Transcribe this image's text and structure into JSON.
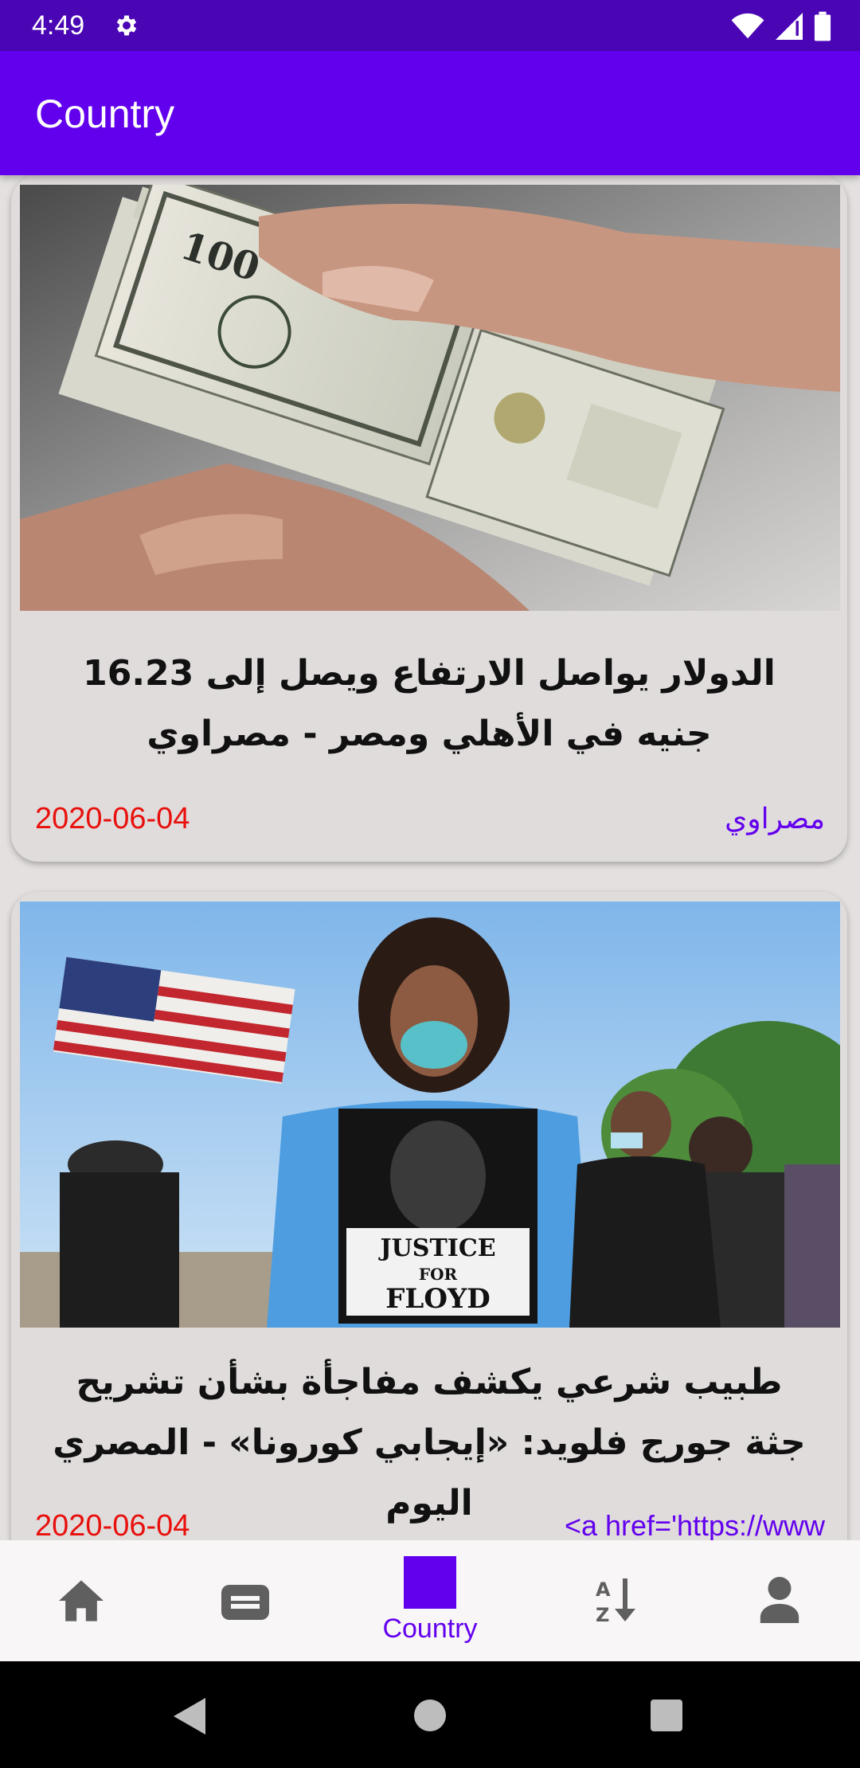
{
  "status_bar": {
    "time": "4:49",
    "icons": [
      "gear-icon",
      "wifi-icon",
      "signal-icon",
      "battery-icon"
    ]
  },
  "app_bar": {
    "title": "Country",
    "color": "#6200ee"
  },
  "articles": [
    {
      "title": "الدولار يواصل الارتفاع ويصل إلى 16.23 جنيه في الأهلي ومصر - مصراوي",
      "date": "2020-06-04",
      "source": "مصراوي",
      "image": "money-photo"
    },
    {
      "title": "طبيب شرعي يكشف مفاجأة بشأن تشريح جثة جورج فلويد: «إيجابي كورونا» - المصري اليوم",
      "date": "2020-06-04",
      "source": "<a href='https://www",
      "image": "protest-photo",
      "image_sign_text": [
        "JUSTICE",
        "FOR",
        "FLOYD"
      ]
    }
  ],
  "bottom_nav": {
    "items": [
      {
        "icon": "home-icon",
        "label": ""
      },
      {
        "icon": "news-icon",
        "label": ""
      },
      {
        "icon": "country-icon",
        "label": "Country",
        "selected": true
      },
      {
        "icon": "sort-az-icon",
        "label": ""
      },
      {
        "icon": "person-icon",
        "label": ""
      }
    ],
    "active_color": "#6200ee",
    "inactive_color": "#5f5f5f"
  },
  "system_nav": {
    "icons": [
      "back-icon",
      "home-circle-icon",
      "recents-icon"
    ]
  },
  "colors": {
    "status_bar": "#4a06b4",
    "date": "#e8100c",
    "source": "#6200ee"
  }
}
